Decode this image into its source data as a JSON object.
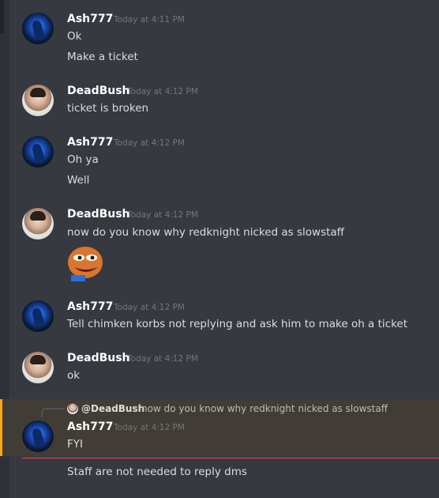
{
  "messages": [
    {
      "author": "Ash777",
      "time": "Today at 4:11 PM",
      "lines": [
        "Ok",
        "Make a ticket"
      ]
    },
    {
      "author": "DeadBush",
      "time": "Today at 4:12 PM",
      "lines": [
        "ticket is broken"
      ]
    },
    {
      "author": "Ash777",
      "time": "Today at 4:12 PM",
      "lines": [
        "Oh ya",
        "Well"
      ]
    },
    {
      "author": "DeadBush",
      "time": "Today at 4:12 PM",
      "lines": [
        "now do you know why redknight nicked as slowstaff"
      ]
    },
    {
      "author": "Ash777",
      "time": "Today at 4:12 PM",
      "lines": [
        "Tell chimken korbs not replying and ask him to make oh a ticket"
      ]
    },
    {
      "author": "DeadBush",
      "time": "Today at 4:12 PM",
      "lines": [
        "ok"
      ]
    },
    {
      "author": "Ash777",
      "time": "Today at 4:12 PM",
      "lines": [
        "FYI",
        "Staff are not needed to reply dms"
      ]
    }
  ],
  "reply": {
    "mention": "@DeadBush",
    "quoted_text": "now do you know why redknight nicked as slowstaff"
  },
  "icons": {
    "emoji": "peepo-emoji",
    "reply_avatar": "deadbush-avatar"
  },
  "colors": {
    "background": "#36393f",
    "username": "#ffffff",
    "message_text": "#dcddde",
    "timestamp": "#72767d",
    "mention_highlight_bg": "#413d36",
    "mention_accent": "#faa61a",
    "new_messages_divider": "#f04747"
  }
}
